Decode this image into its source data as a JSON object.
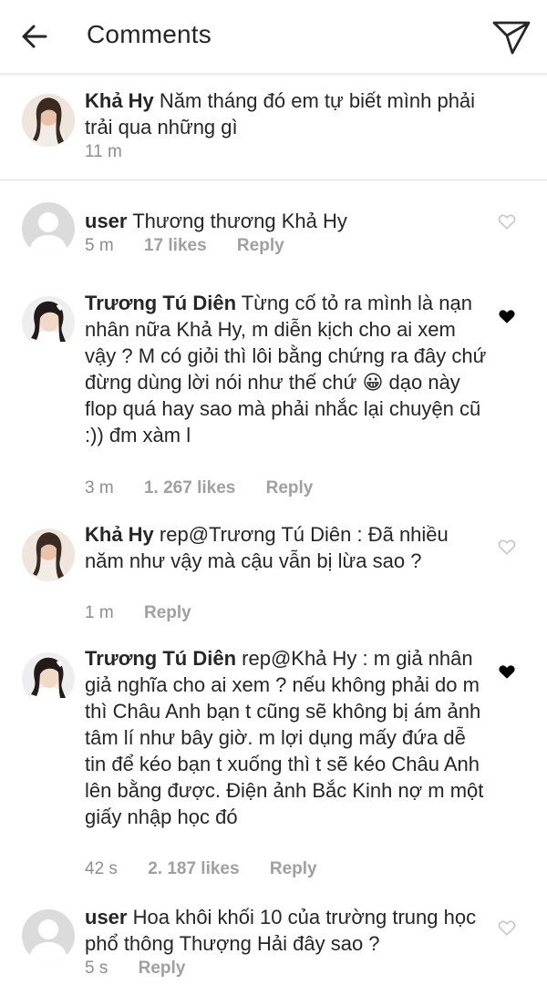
{
  "header": {
    "title": "Comments",
    "back_icon": "arrow-left-icon",
    "send_icon": "paper-plane-icon"
  },
  "caption": {
    "username": "Khả Hy",
    "text": "Năm tháng đó em tự biết mình phải trải qua những gì",
    "time": "11 m"
  },
  "comments": [
    {
      "username": "user",
      "text": "Thương thương Khả Hy",
      "time": "5 m",
      "likes": "17 likes",
      "reply": "Reply",
      "liked": false
    },
    {
      "username": "Trương Tú Diên",
      "text": "Từng cố tỏ ra mình là nạn nhân nữa Khả Hy,  m diễn kịch cho ai xem vậy ?  M có giỏi thì lôi bằng chứng ra đây chứ đừng dùng lời nói như thế chứ 😀 dạo này flop quá hay sao mà phải nhắc lại chuyện cũ :)) đm xàm l",
      "time": "3 m",
      "likes": "1. 267 likes",
      "reply": "Reply",
      "liked": true
    },
    {
      "username": "Khả Hy",
      "text": "rep@Trương Tú Diên :  Đã nhiều năm như vậy mà cậu vẫn bị lừa sao ?",
      "time": "1 m",
      "likes": "",
      "reply": "Reply",
      "liked": false
    },
    {
      "username": "Trương Tú Diên",
      "text": "rep@Khả Hy :  m giả nhân giả nghĩa cho ai xem ?  nếu không phải do m thì Châu Anh bạn t cũng sẽ không bị ám ảnh tâm lí như bây giờ. m lợi dụng mấy đứa dễ tin để kéo bạn t xuống thì t sẽ kéo Châu Anh lên bằng được.  Điện ảnh Bắc Kinh nợ m một giấy nhập học đó",
      "time": "42 s",
      "likes": "2. 187 likes",
      "reply": "Reply",
      "liked": true
    },
    {
      "username": "user",
      "text": "Hoa khôi khối 10 của trường trung học phổ thông Thượng Hải đây sao ?",
      "time": "5 s",
      "likes": "",
      "reply": "Reply",
      "liked": false
    }
  ],
  "colors": {
    "text": "#262626",
    "meta": "#8e8e8e",
    "divider": "#dbdbdb",
    "heart_filled": "#000000",
    "heart_outline": "#c7c7c7"
  }
}
